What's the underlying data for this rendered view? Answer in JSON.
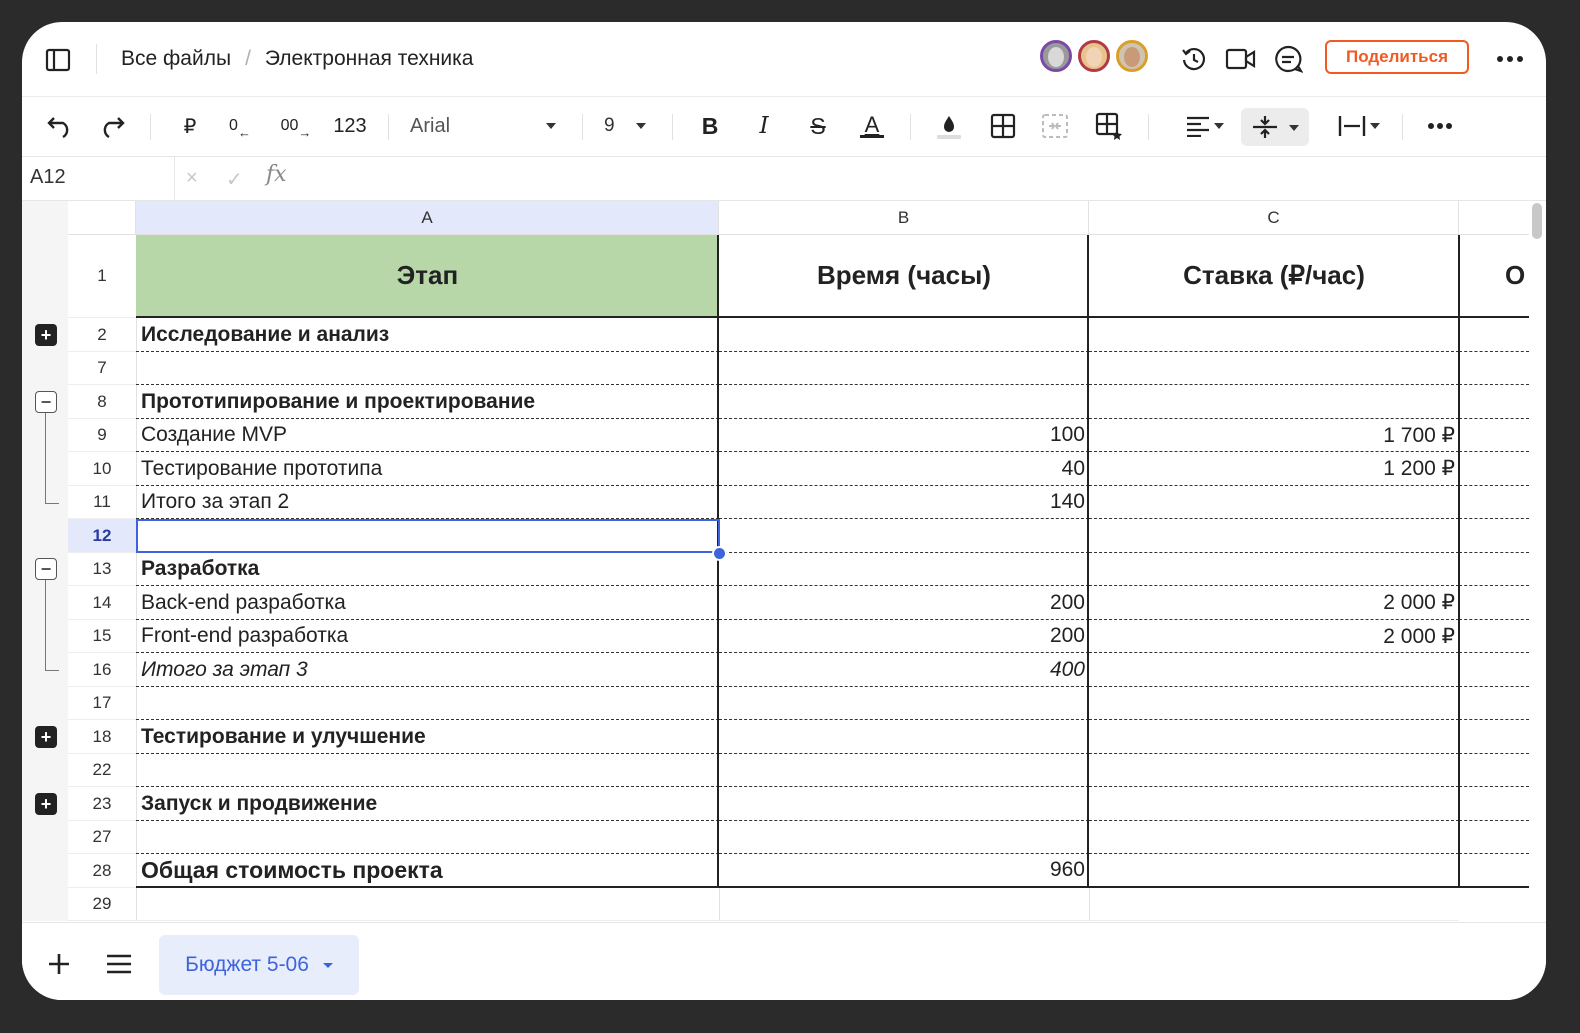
{
  "breadcrumb": {
    "root": "Все файлы",
    "separator": "/",
    "current": "Электронная техника"
  },
  "share": {
    "label": "Поделиться"
  },
  "toolbar": {
    "currency": "₽",
    "decrease_decimals": "0",
    "increase_decimals": "00",
    "number_format": "123",
    "font": "Arial",
    "font_size": "9",
    "bold": "B",
    "italic": "I",
    "strike": "S",
    "text_color": "A"
  },
  "formula_bar": {
    "cell_ref": "A12",
    "cancel": "×",
    "confirm": "✓",
    "fx": "fx",
    "value": ""
  },
  "columns": [
    "A",
    "B",
    "C"
  ],
  "rows": [
    {
      "num": "1",
      "a": "Этап",
      "b": "Время (часы)",
      "c": "Ставка (₽/час)",
      "d": "О"
    },
    {
      "num": "2",
      "a": "Исследование и анализ",
      "b": "",
      "c": ""
    },
    {
      "num": "7",
      "a": "",
      "b": "",
      "c": ""
    },
    {
      "num": "8",
      "a": "Прототипирование и проектирование",
      "b": "",
      "c": ""
    },
    {
      "num": "9",
      "a": "Создание MVP",
      "b": "100",
      "c": "1 700 ₽"
    },
    {
      "num": "10",
      "a": "Тестирование прототипа",
      "b": "40",
      "c": "1 200 ₽"
    },
    {
      "num": "11",
      "a": "Итого за этап 2",
      "b": "140",
      "c": ""
    },
    {
      "num": "12",
      "a": "",
      "b": "",
      "c": ""
    },
    {
      "num": "13",
      "a": "Разработка",
      "b": "",
      "c": ""
    },
    {
      "num": "14",
      "a": "Back-end разработка",
      "b": "200",
      "c": "2 000 ₽"
    },
    {
      "num": "15",
      "a": "Front-end разработка",
      "b": "200",
      "c": "2 000 ₽"
    },
    {
      "num": "16",
      "a": "Итого за этап 3",
      "b": "400",
      "c": ""
    },
    {
      "num": "17",
      "a": "",
      "b": "",
      "c": ""
    },
    {
      "num": "18",
      "a": "Тестирование и улучшение",
      "b": "",
      "c": ""
    },
    {
      "num": "22",
      "a": "",
      "b": "",
      "c": ""
    },
    {
      "num": "23",
      "a": "Запуск и продвижение",
      "b": "",
      "c": ""
    },
    {
      "num": "27",
      "a": "",
      "b": "",
      "c": ""
    },
    {
      "num": "28",
      "a": "Общая стоимость проекта",
      "b": "960",
      "c": ""
    },
    {
      "num": "29",
      "a": "",
      "b": "",
      "c": ""
    }
  ],
  "sheet": {
    "tab_label": "Бюджет 5-06"
  },
  "colors": {
    "accent": "#3d63dd",
    "share": "#f05a22",
    "header_fill": "#b7d7a8"
  }
}
